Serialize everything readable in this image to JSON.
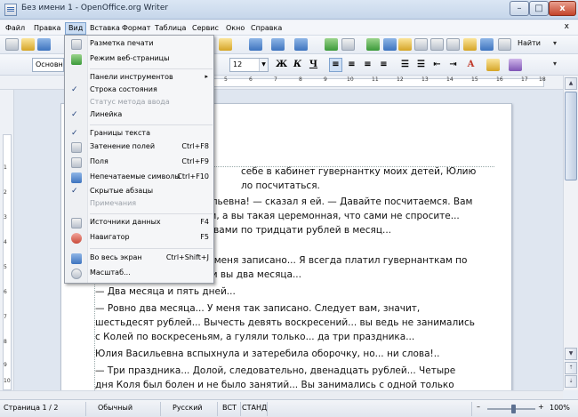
{
  "window": {
    "title": "Без имени 1 - OpenOffice.org Writer",
    "min_glyph": "–",
    "max_glyph": "□",
    "close_glyph": "x",
    "close_doc_glyph": "x"
  },
  "menubar": {
    "items": [
      {
        "label": "Файл"
      },
      {
        "label": "Правка"
      },
      {
        "label": "Вид"
      },
      {
        "label": "Вставка"
      },
      {
        "label": "Формат"
      },
      {
        "label": "Таблица"
      },
      {
        "label": "Сервис"
      },
      {
        "label": "Окно"
      },
      {
        "label": "Справка"
      }
    ],
    "active_index": 2
  },
  "toolbar_standard": {
    "search_label": "Найти",
    "icon_names": [
      "new-doc-icon",
      "open-icon",
      "save-icon",
      "paste-icon",
      "format-paint-icon",
      "undo-icon",
      "redo-icon",
      "navigator-icon",
      "table-icon",
      "image-icon",
      "chart-icon",
      "pilcrow-icon",
      "gallery-icon",
      "zoom-icon",
      "help-icon"
    ]
  },
  "toolbar_formatting": {
    "style_value": "Основн",
    "font_size_value": "12",
    "bold_label": "Ж",
    "italic_label": "К",
    "underline_label": "Ч",
    "font_color_label": "A"
  },
  "ruler": {
    "h_numbers": [
      "1",
      "2",
      "3",
      "4",
      "5",
      "6",
      "7",
      "8",
      "9",
      "10",
      "11",
      "12",
      "13",
      "14",
      "15",
      "16",
      "17",
      "18"
    ],
    "v_numbers": [
      "1",
      "2",
      "3",
      "4",
      "5",
      "6",
      "7",
      "8",
      "9",
      "10"
    ]
  },
  "view_menu": {
    "items": [
      {
        "label": "Разметка печати",
        "check": false,
        "icon": "print-layout-icon",
        "shortcut": "",
        "disabled": false
      },
      {
        "label": "Режим веб-страницы",
        "check": false,
        "icon": "web-layout-icon",
        "shortcut": "",
        "disabled": false
      },
      {
        "label": "Панели инструментов",
        "check": false,
        "icon": "",
        "shortcut": "",
        "disabled": false,
        "submenu": true
      },
      {
        "label": "Строка состояния",
        "check": true,
        "icon": "",
        "shortcut": "",
        "disabled": false
      },
      {
        "label": "Статус метода ввода",
        "check": false,
        "icon": "",
        "shortcut": "",
        "disabled": true
      },
      {
        "label": "Линейка",
        "check": true,
        "icon": "",
        "shortcut": "",
        "disabled": false
      },
      {
        "label": "Границы текста",
        "check": true,
        "icon": "",
        "shortcut": "",
        "disabled": false
      },
      {
        "label": "Затенение полей",
        "check": false,
        "icon": "field-shading-icon",
        "shortcut": "Ctrl+F8",
        "disabled": false
      },
      {
        "label": "Поля",
        "check": false,
        "icon": "fields-icon",
        "shortcut": "Ctrl+F9",
        "disabled": false
      },
      {
        "label": "Непечатаемые символы",
        "check": false,
        "icon": "pilcrow-icon",
        "shortcut": "Ctrl+F10",
        "disabled": false
      },
      {
        "label": "Скрытые абзацы",
        "check": true,
        "icon": "",
        "shortcut": "",
        "disabled": false
      },
      {
        "label": "Примечания",
        "check": false,
        "icon": "",
        "shortcut": "",
        "disabled": true
      },
      {
        "label": "Источники данных",
        "check": false,
        "icon": "data-sources-icon",
        "shortcut": "F4",
        "disabled": false
      },
      {
        "label": "Навигатор",
        "check": false,
        "icon": "navigator-icon",
        "shortcut": "F5",
        "disabled": false
      },
      {
        "label": "Во весь экран",
        "check": false,
        "icon": "full-screen-icon",
        "shortcut": "Ctrl+Shift+J",
        "disabled": false
      },
      {
        "label": "Масштаб...",
        "check": false,
        "icon": "zoom-icon",
        "shortcut": "",
        "disabled": false
      }
    ]
  },
  "document": {
    "paragraphs": [
      "себе в кабинет гувернантку моих детей, Юлию",
      "ло посчитаться.",
      "ильевна! — сказал я ей. — Давайте посчитаемся. Вам",
      "ги, а вы такая церемонная, что сами не спросите...",
      "с вами по тридцати рублей в месяц...",
      "У меня записано... Я всегда платил гувернанткам по",
      "ли вы два месяца...",
      "— Два месяца и пять дней...",
      "— Ровно два месяца... У меня так записано. Следует вам, значит,",
      "шестьдесят рублей... Вычесть девять воскресений... вы ведь не занимались",
      "с Колей по воскресеньям, а гуляли только... да три праздника...",
      "Юлия Васильевна вспыхнула и затеребила оборочку, но... ни слова!..",
      "— Три праздника... Долой, следовательно, двенадцать рублей... Четыре",
      "дня Коля был болен и не было занятий... Вы занимались с одной только"
    ]
  },
  "statusbar": {
    "page": "Страница 1 / 2",
    "style": "Обычный",
    "language": "Русский",
    "insert_mode": "ВСТ",
    "selection_mode": "СТАНД",
    "zoom": "100%",
    "zoom_fraction": 0.55
  }
}
